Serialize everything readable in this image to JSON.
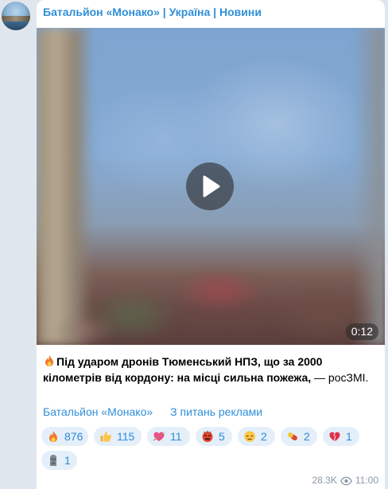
{
  "channel": {
    "title": "Батальйон «Монако» | Україна | Новини"
  },
  "video": {
    "duration": "0:12"
  },
  "post": {
    "text_bold": "Під ударом дронів Тюменський НПЗ, що за 2000 кілометрів від кордону: на місці сильна пожежа,",
    "text_normal": " — росЗМІ."
  },
  "links": {
    "channel_link": "Батальйон «Монако»",
    "ads_link": "З питань реклами"
  },
  "reactions": [
    {
      "icon": "fire-icon",
      "count": "876"
    },
    {
      "icon": "thumbs-up-icon",
      "count": "115"
    },
    {
      "icon": "heart-arrow-icon",
      "count": "11"
    },
    {
      "icon": "angry-face-icon",
      "count": "5"
    },
    {
      "icon": "relieved-face-icon",
      "count": "2"
    },
    {
      "icon": "pill-icon",
      "count": "2"
    },
    {
      "icon": "broken-heart-icon",
      "count": "1"
    },
    {
      "icon": "moai-icon",
      "count": "1"
    }
  ],
  "meta": {
    "views": "28.3K",
    "time": "11:00"
  },
  "colors": {
    "accent": "#2f8fd8",
    "reaction_bg": "#e4eff9",
    "chat_bg": "#dfe6ee"
  }
}
